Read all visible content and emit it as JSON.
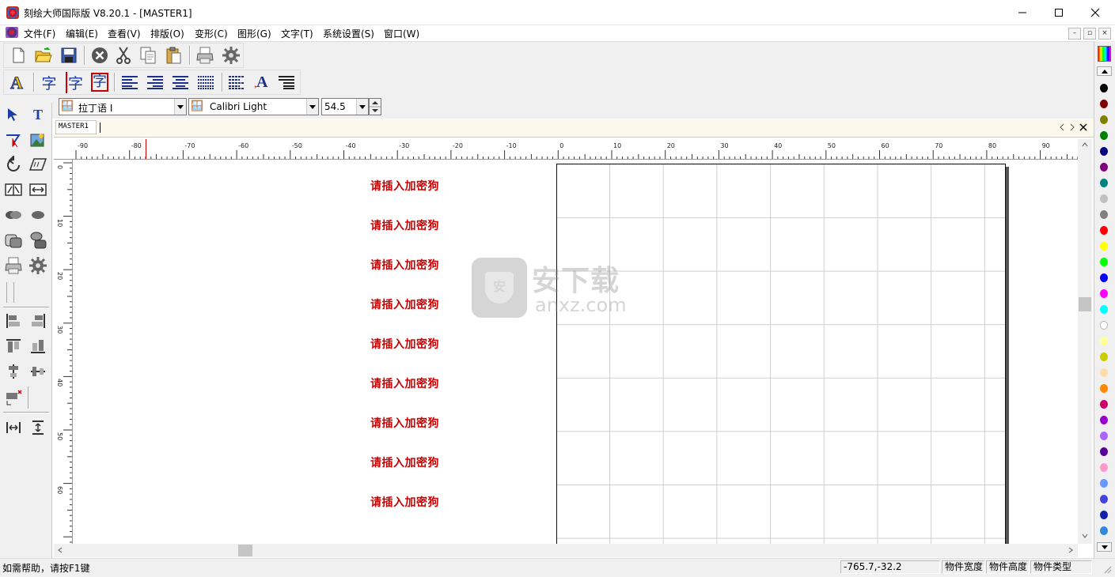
{
  "window": {
    "title": "刻绘大师国际版 V8.20.1 - [MASTER1]",
    "minimize_icon": "minimize-icon",
    "maximize_icon": "maximize-icon",
    "close_icon": "close-icon"
  },
  "menu": {
    "items": [
      "文件(F)",
      "编辑(E)",
      "查看(V)",
      "排版(O)",
      "变形(C)",
      "图形(G)",
      "文字(T)",
      "系统设置(S)",
      "窗口(W)"
    ]
  },
  "toolbar": {
    "row1_icons": [
      "new-file-icon",
      "open-folder-icon",
      "save-icon",
      "delete-icon",
      "cut-icon",
      "copy-icon",
      "paste-icon",
      "print-icon",
      "settings-gear-icon"
    ],
    "row2_icons": [
      "text-style-icon",
      "char-icon",
      "char-outline-icon",
      "char-box-icon",
      "align-left-icon",
      "align-right-icon",
      "align-center-icon",
      "align-justify-icon",
      "line-spacing-icon",
      "font-size-icon",
      "paragraph-icon"
    ],
    "char_glyph": "字",
    "font_size_glyph": "A"
  },
  "fontbar": {
    "script": "拉丁语 I",
    "font": "Calibri Light",
    "size": "54.5"
  },
  "tabs": {
    "active": "MASTER1"
  },
  "ruler": {
    "h_labels": [
      "-90",
      "-80",
      "-70",
      "-60",
      "-50",
      "-40",
      "-30",
      "-20",
      "-10",
      "0",
      "10",
      "20",
      "30",
      "40",
      "50",
      "60",
      "70",
      "80",
      "90"
    ],
    "v_labels": [
      "0",
      "10",
      "20",
      "30",
      "40",
      "50",
      "60"
    ]
  },
  "canvas": {
    "messages": [
      "请插入加密狗",
      "请插入加密狗",
      "请插入加密狗",
      "请插入加密狗",
      "请插入加密狗",
      "请插入加密狗",
      "请插入加密狗",
      "请插入加密狗",
      "请插入加密狗"
    ],
    "watermark_text": "安下载",
    "watermark_sub": "anxz.com",
    "watermark_badge": "安"
  },
  "palette": {
    "colors": [
      "#000000",
      "#800000",
      "#808000",
      "#008000",
      "#000080",
      "#800080",
      "#008080",
      "#c0c0c0",
      "#808080",
      "#ff0000",
      "#ffff00",
      "#00ff00",
      "#0000ff",
      "#ff00ff",
      "#00ffff",
      "#ffffff",
      "#ffff99",
      "#cccc00",
      "#ffddaa",
      "#ff8800",
      "#cc0066",
      "#9900cc",
      "#aa66ff",
      "#550099",
      "#ff99cc",
      "#6699ff",
      "#4444dd",
      "#1122aa",
      "#3388dd"
    ]
  },
  "status": {
    "help": "如需帮助，请按F1键",
    "coords": "-765.7,-32.2",
    "width_label": "物件宽度",
    "height_label": "物件高度",
    "type_label": "物件类型"
  }
}
